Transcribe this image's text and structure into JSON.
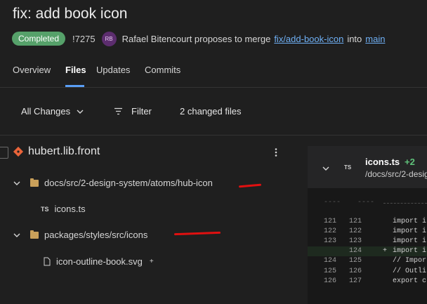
{
  "pr": {
    "title": "fix: add book icon",
    "status": "Completed",
    "id": "!7275",
    "avatar_initials": "RB",
    "author_text": "Rafael Bitencourt proposes to merge",
    "source_branch": "fix/add-book-icon",
    "into_text": "into",
    "target_branch": "main"
  },
  "tabs": [
    {
      "label": "Overview"
    },
    {
      "label": "Files"
    },
    {
      "label": "Updates"
    },
    {
      "label": "Commits"
    }
  ],
  "toolbar": {
    "all_changes": "All Changes",
    "filter": "Filter",
    "changed_files": "2 changed files"
  },
  "tree": {
    "repo": "hubert.lib.front",
    "folder1": "docs/src/2-design-system/atoms/hub-icon",
    "file1_type": "TS",
    "file1": "icons.ts",
    "folder2": "packages/styles/src/icons",
    "file2": "icon-outline-book.svg",
    "file2_action": "+"
  },
  "diff": {
    "file_type": "TS",
    "file_name": "icons.ts",
    "additions": "+2",
    "path": "/docs/src/2-desig",
    "separator": "----    ----",
    "lines": [
      {
        "old": "121",
        "new": "121",
        "marker": " ",
        "text": "import i"
      },
      {
        "old": "122",
        "new": "122",
        "marker": " ",
        "text": "import i"
      },
      {
        "old": "123",
        "new": "123",
        "marker": " ",
        "text": "import i"
      },
      {
        "old": "",
        "new": "124",
        "marker": "+",
        "text": "import i"
      },
      {
        "old": "124",
        "new": "125",
        "marker": " ",
        "text": "// Impor"
      },
      {
        "old": "125",
        "new": "126",
        "marker": " ",
        "text": "// Outli"
      },
      {
        "old": "126",
        "new": "127",
        "marker": " ",
        "text": "export c"
      }
    ]
  },
  "colors": {
    "accent": "#5a9ef5",
    "badge": "#56a16a",
    "link": "#6fb0f5",
    "annotation": "#e01010",
    "repo_icon": "#e9643a"
  }
}
